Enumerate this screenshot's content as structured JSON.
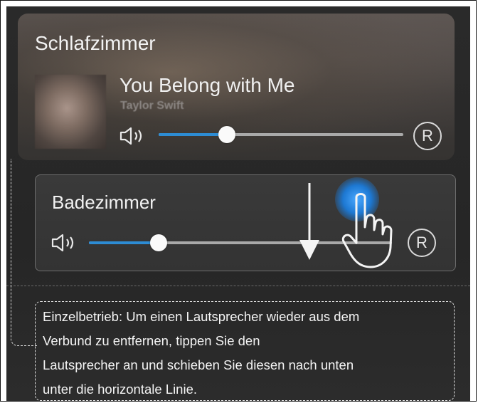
{
  "colors": {
    "accent": "#2d8cd4",
    "background": "#262626",
    "text": "#f2f2f2"
  },
  "rooms": [
    {
      "name": "Schlafzimmer",
      "now_playing": {
        "title": "You Belong with Me",
        "artist": "Taylor Swift"
      },
      "volume_percent": 28,
      "button_label": "R"
    },
    {
      "name": "Badezimmer",
      "volume_percent": 23,
      "button_label": "R"
    }
  ],
  "hint": {
    "lines": [
      "Einzelbetrieb: Um einen Lautsprecher wieder aus dem",
      "Verbund zu entfernen, tippen Sie den",
      "Lautsprecher an und schieben Sie diesen nach unten",
      "unter die horizontale Linie."
    ]
  },
  "icons": {
    "speaker": "speaker-icon",
    "gesture": "hand-pointer-icon",
    "direction": "arrow-down-icon"
  }
}
